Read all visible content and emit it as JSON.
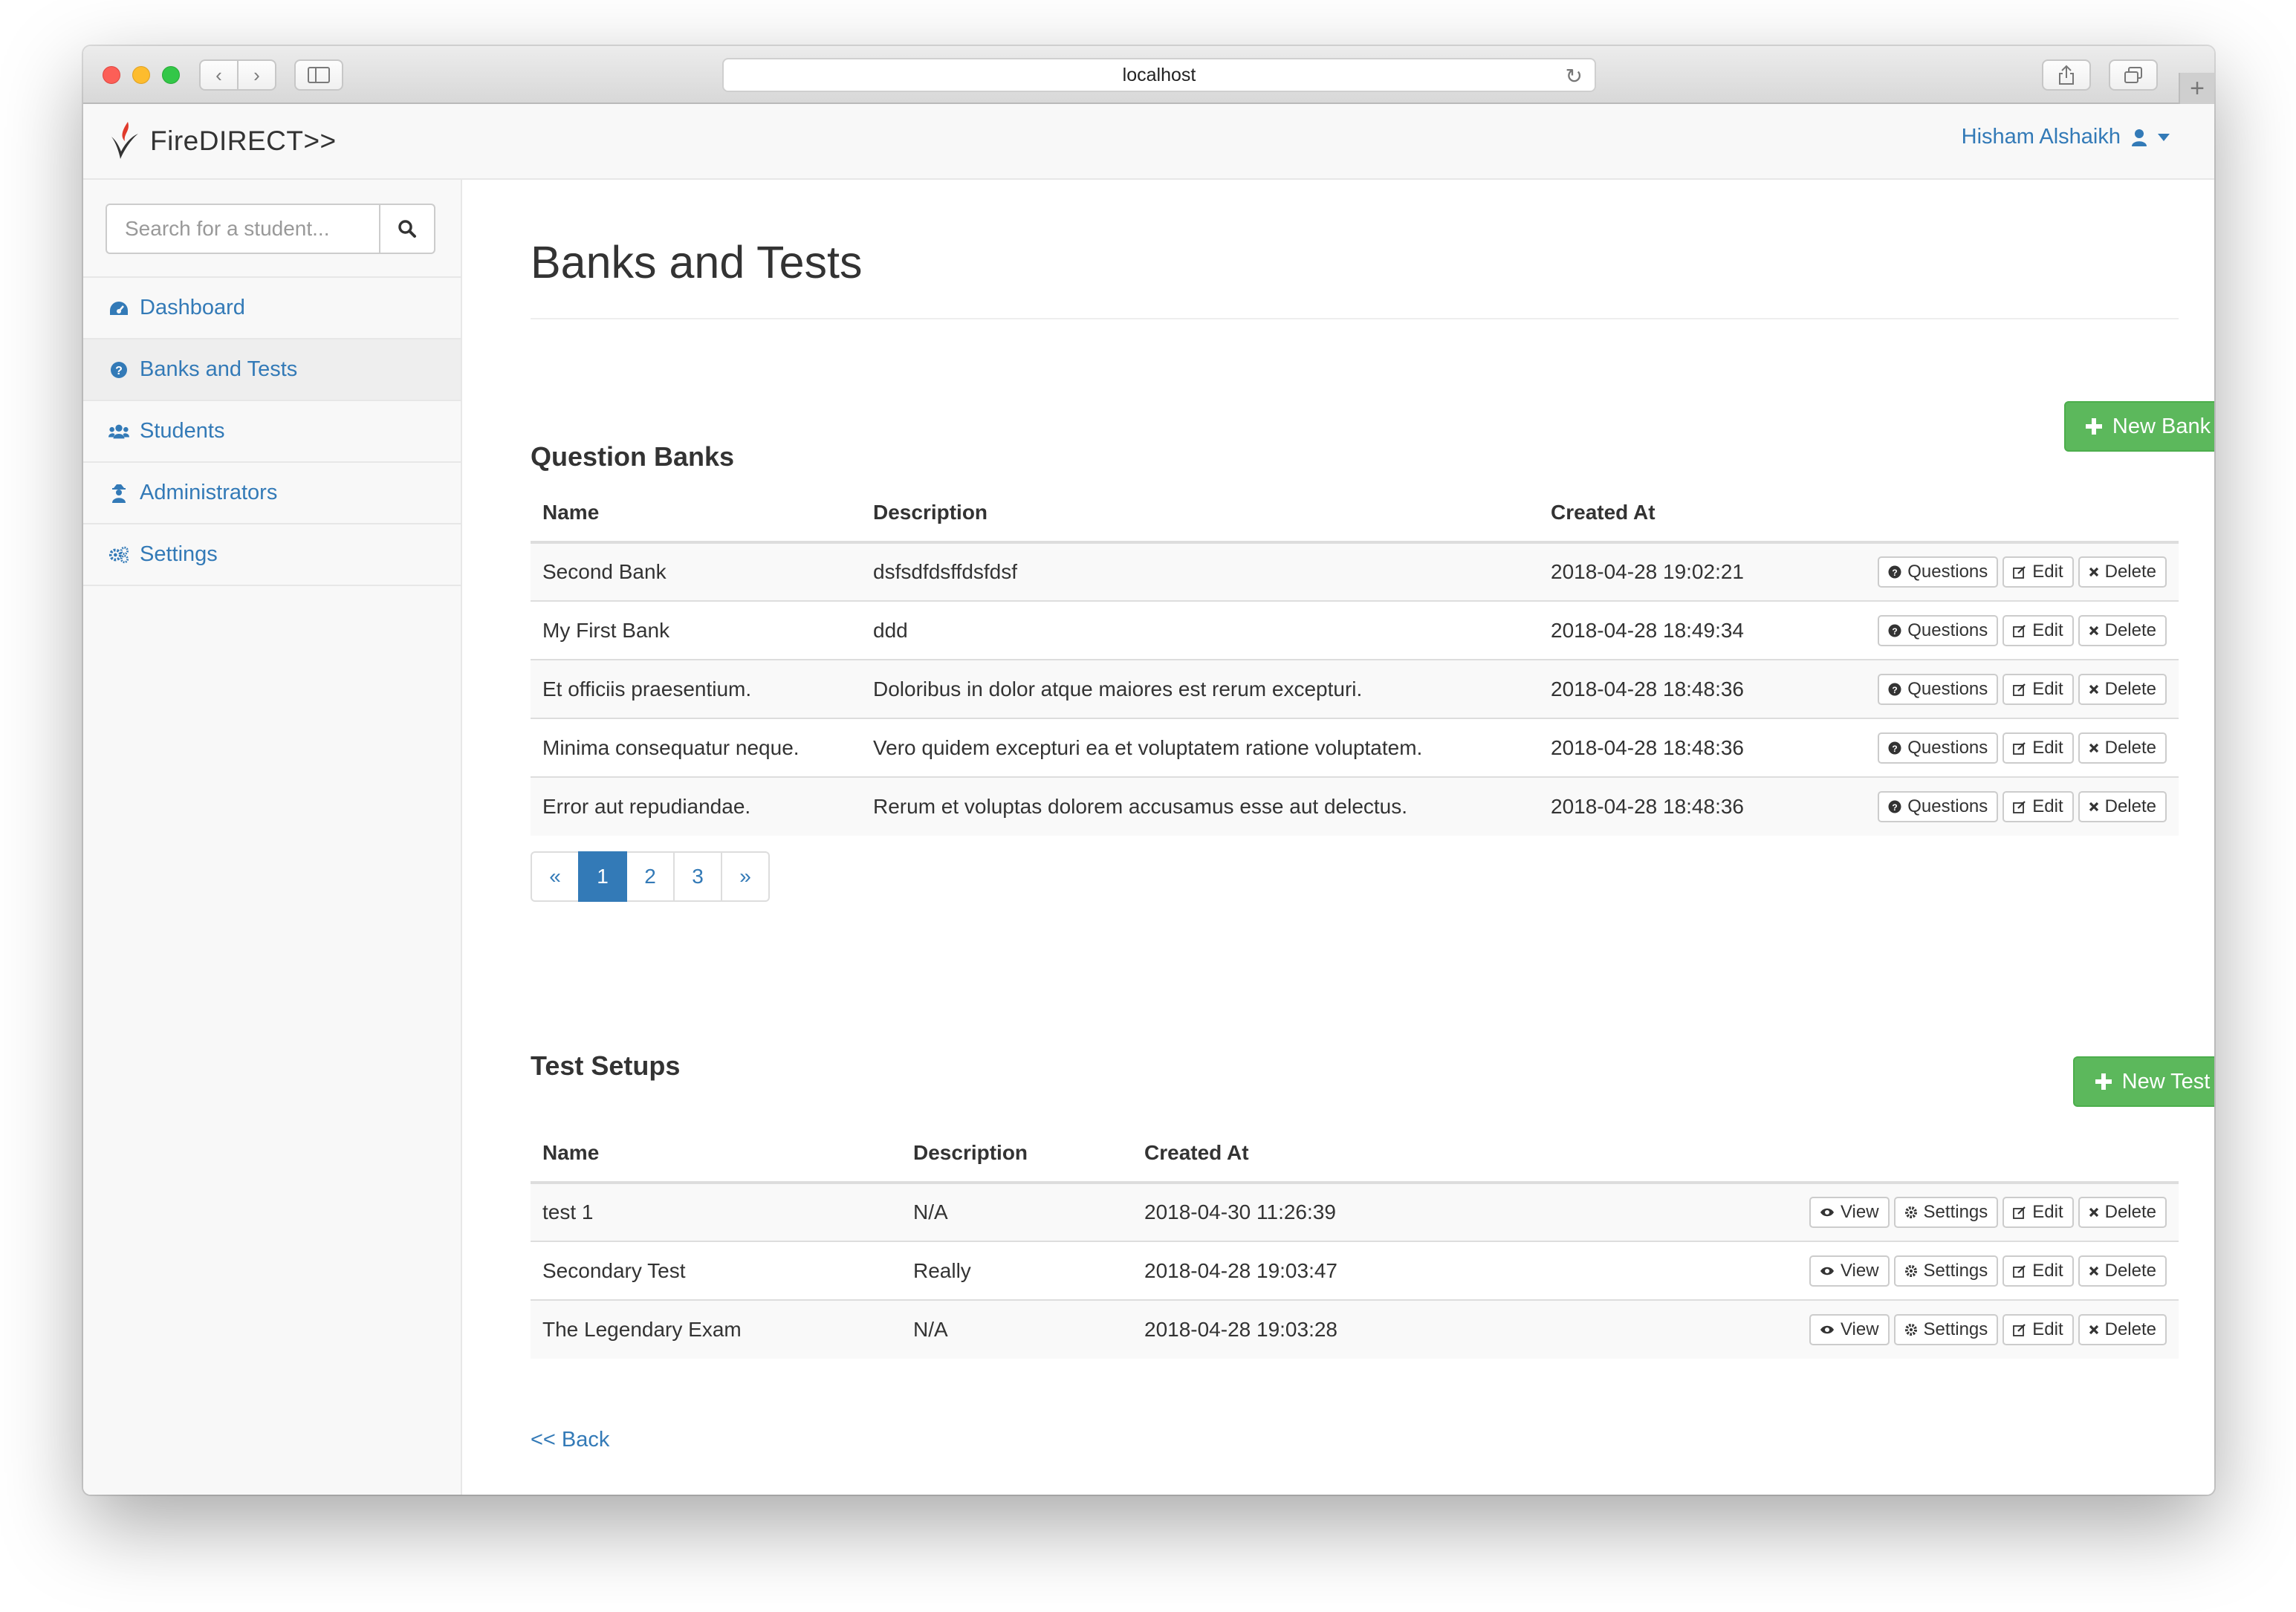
{
  "browser": {
    "url": "localhost"
  },
  "navbar": {
    "brand": "FireDIRECT>>",
    "user_name": "Hisham Alshaikh"
  },
  "sidebar": {
    "search_placeholder": "Search for a student...",
    "items": [
      {
        "label": "Dashboard",
        "icon": "dashboard-icon"
      },
      {
        "label": "Banks and Tests",
        "icon": "question-circle-icon",
        "active": true
      },
      {
        "label": "Students",
        "icon": "users-icon"
      },
      {
        "label": "Administrators",
        "icon": "user-secret-icon"
      },
      {
        "label": "Settings",
        "icon": "cogs-icon"
      }
    ]
  },
  "main": {
    "title": "Banks and Tests",
    "banks": {
      "title": "Question Banks",
      "new_button": "New Bank",
      "columns": [
        "Name",
        "Description",
        "Created At"
      ],
      "rows": [
        {
          "name": "Second Bank",
          "description": "dsfsdfdsffdsfdsf",
          "created_at": "2018-04-28 19:02:21"
        },
        {
          "name": "My First Bank",
          "description": "ddd",
          "created_at": "2018-04-28 18:49:34"
        },
        {
          "name": "Et officiis praesentium.",
          "description": "Doloribus in dolor atque maiores est rerum excepturi.",
          "created_at": "2018-04-28 18:48:36"
        },
        {
          "name": "Minima consequatur neque.",
          "description": "Vero quidem excepturi ea et voluptatem ratione voluptatem.",
          "created_at": "2018-04-28 18:48:36"
        },
        {
          "name": "Error aut repudiandae.",
          "description": "Rerum et voluptas dolorem accusamus esse aut delectus.",
          "created_at": "2018-04-28 18:48:36"
        }
      ],
      "actions": {
        "questions": "Questions",
        "edit": "Edit",
        "delete": "Delete"
      },
      "pagination": {
        "prev": "«",
        "pages": [
          "1",
          "2",
          "3"
        ],
        "current": "1",
        "next": "»"
      }
    },
    "tests": {
      "title": "Test Setups",
      "new_button": "New Test",
      "columns": [
        "Name",
        "Description",
        "Created At"
      ],
      "rows": [
        {
          "name": "test 1",
          "description": "N/A",
          "created_at": "2018-04-30 11:26:39"
        },
        {
          "name": "Secondary Test",
          "description": "Really",
          "created_at": "2018-04-28 19:03:47"
        },
        {
          "name": "The Legendary Exam",
          "description": "N/A",
          "created_at": "2018-04-28 19:03:28"
        }
      ],
      "actions": {
        "view": "View",
        "settings": "Settings",
        "edit": "Edit",
        "delete": "Delete"
      }
    },
    "back_link": "<< Back"
  },
  "colors": {
    "link": "#337ab7",
    "success": "#5cb85c",
    "sidebar_bg": "#f8f8f8",
    "active_item_bg": "#eeeeee"
  }
}
